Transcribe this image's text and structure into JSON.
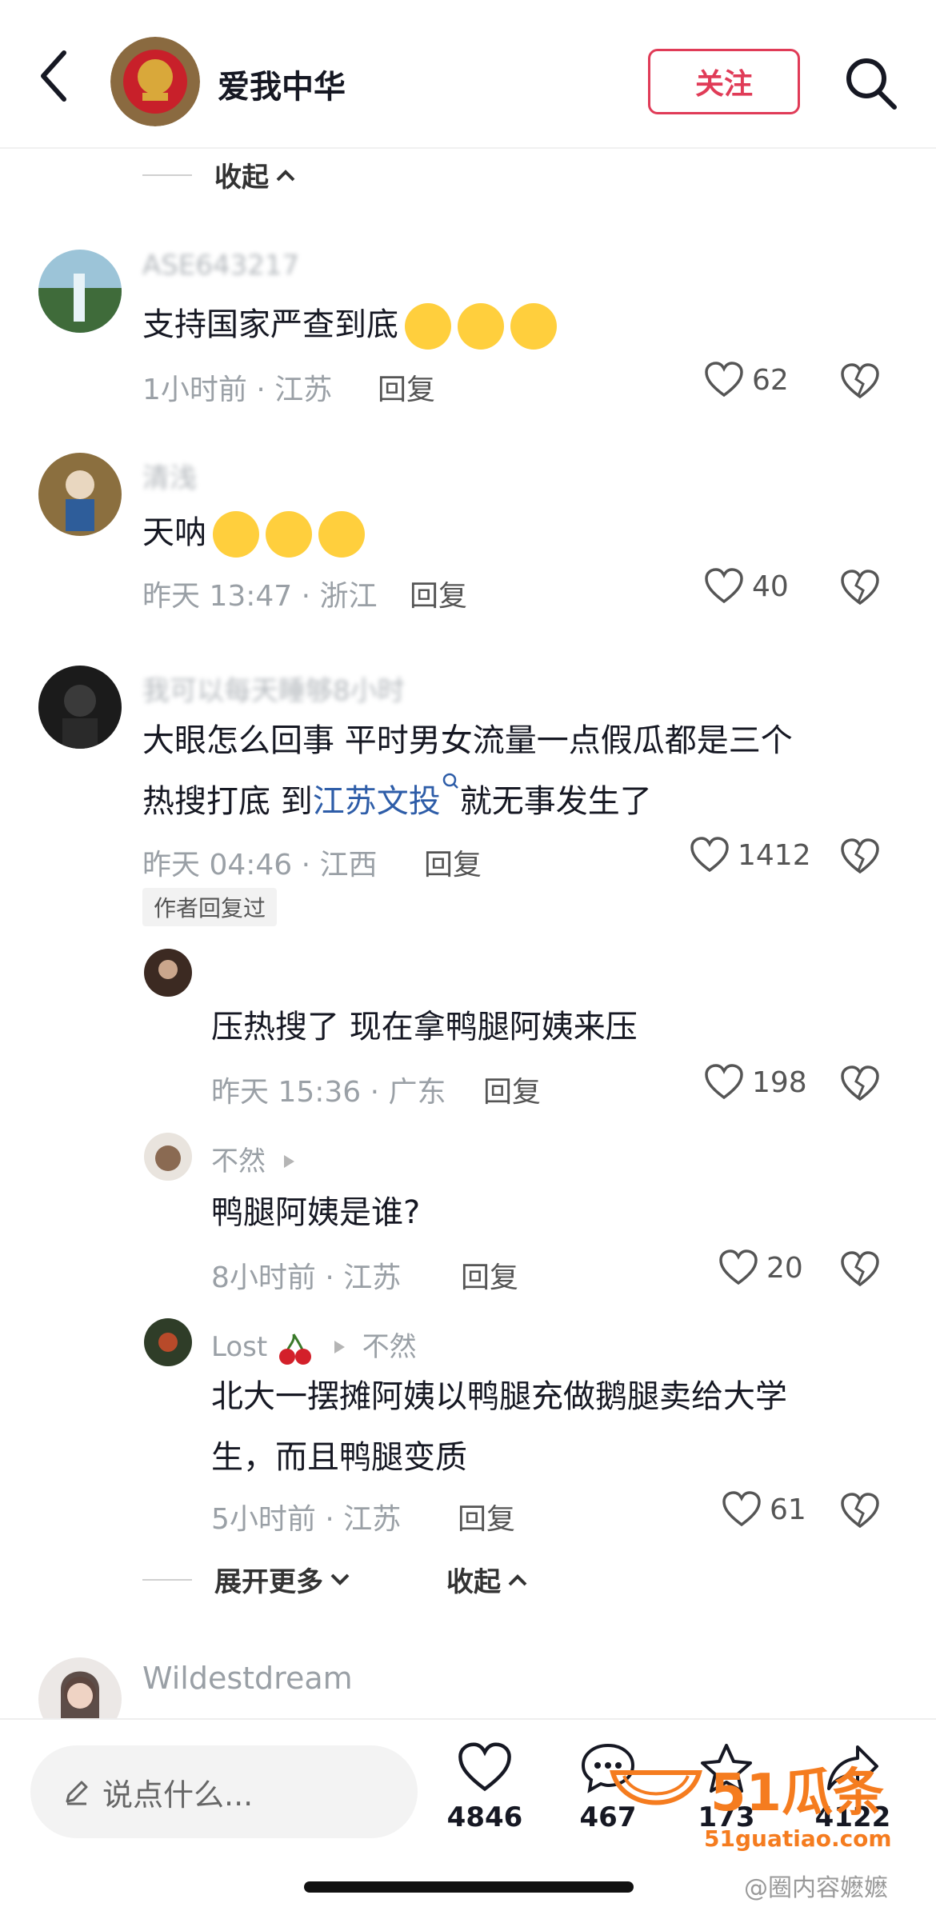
{
  "header": {
    "title": "爱我中华",
    "follow_label": "关注",
    "back_icon": "chevron-left-icon",
    "search_icon": "search-icon"
  },
  "thread": {
    "collapse_label": "收起"
  },
  "comments": [
    {
      "user": "ASE643217",
      "text": "支持国家严查到底",
      "time_loc": "1小时前 · 江苏",
      "reply_label": "回复",
      "likes": "62"
    },
    {
      "user": "清浅",
      "text": "天呐",
      "time_loc": "昨天 13:47 · 浙江",
      "reply_label": "回复",
      "likes": "40"
    },
    {
      "user": "我可以每天睡够8小时",
      "text_line1": "大眼怎么回事 平时男女流量一点假瓜都是三个",
      "text_line2_prefix": "热搜打底 到",
      "text_link": "江苏文投",
      "text_line2_suffix": "就无事发生了",
      "time_loc": "昨天 04:46 · 江西",
      "reply_label": "回复",
      "likes": "1412",
      "author_tag": "作者回复过"
    }
  ],
  "replies": [
    {
      "user": "",
      "text": "压热搜了 现在拿鸭腿阿姨来压",
      "time_loc": "昨天 15:36 · 广东",
      "reply_label": "回复",
      "likes": "198"
    },
    {
      "user": "不然",
      "text": "鸭腿阿姨是谁?",
      "time_loc": "8小时前 · 江苏",
      "reply_label": "回复",
      "likes": "20"
    },
    {
      "user": "Lost",
      "reply_to": "不然",
      "text_line1": "北大一摆摊阿姨以鸭腿充做鹅腿卖给大学",
      "text_line2": "生，而且鸭腿变质",
      "time_loc": "5小时前 · 江苏",
      "reply_label": "回复",
      "likes": "61"
    }
  ],
  "expand": {
    "more_label": "展开更多",
    "collapse_label": "收起"
  },
  "last_comment": {
    "user": "Wildestdream"
  },
  "bottom_bar": {
    "input_placeholder": "说点什么...",
    "like_count": "4846",
    "comment_count": "467",
    "star_count": "173",
    "share_count": "4122"
  },
  "watermark": {
    "brand": "51瓜条",
    "site": "51guatiao.com",
    "credit": "@圈内容嬷嬷"
  },
  "colors": {
    "accent": "#e03b57",
    "link": "#2e5da8",
    "muted": "#9aa0a6"
  }
}
